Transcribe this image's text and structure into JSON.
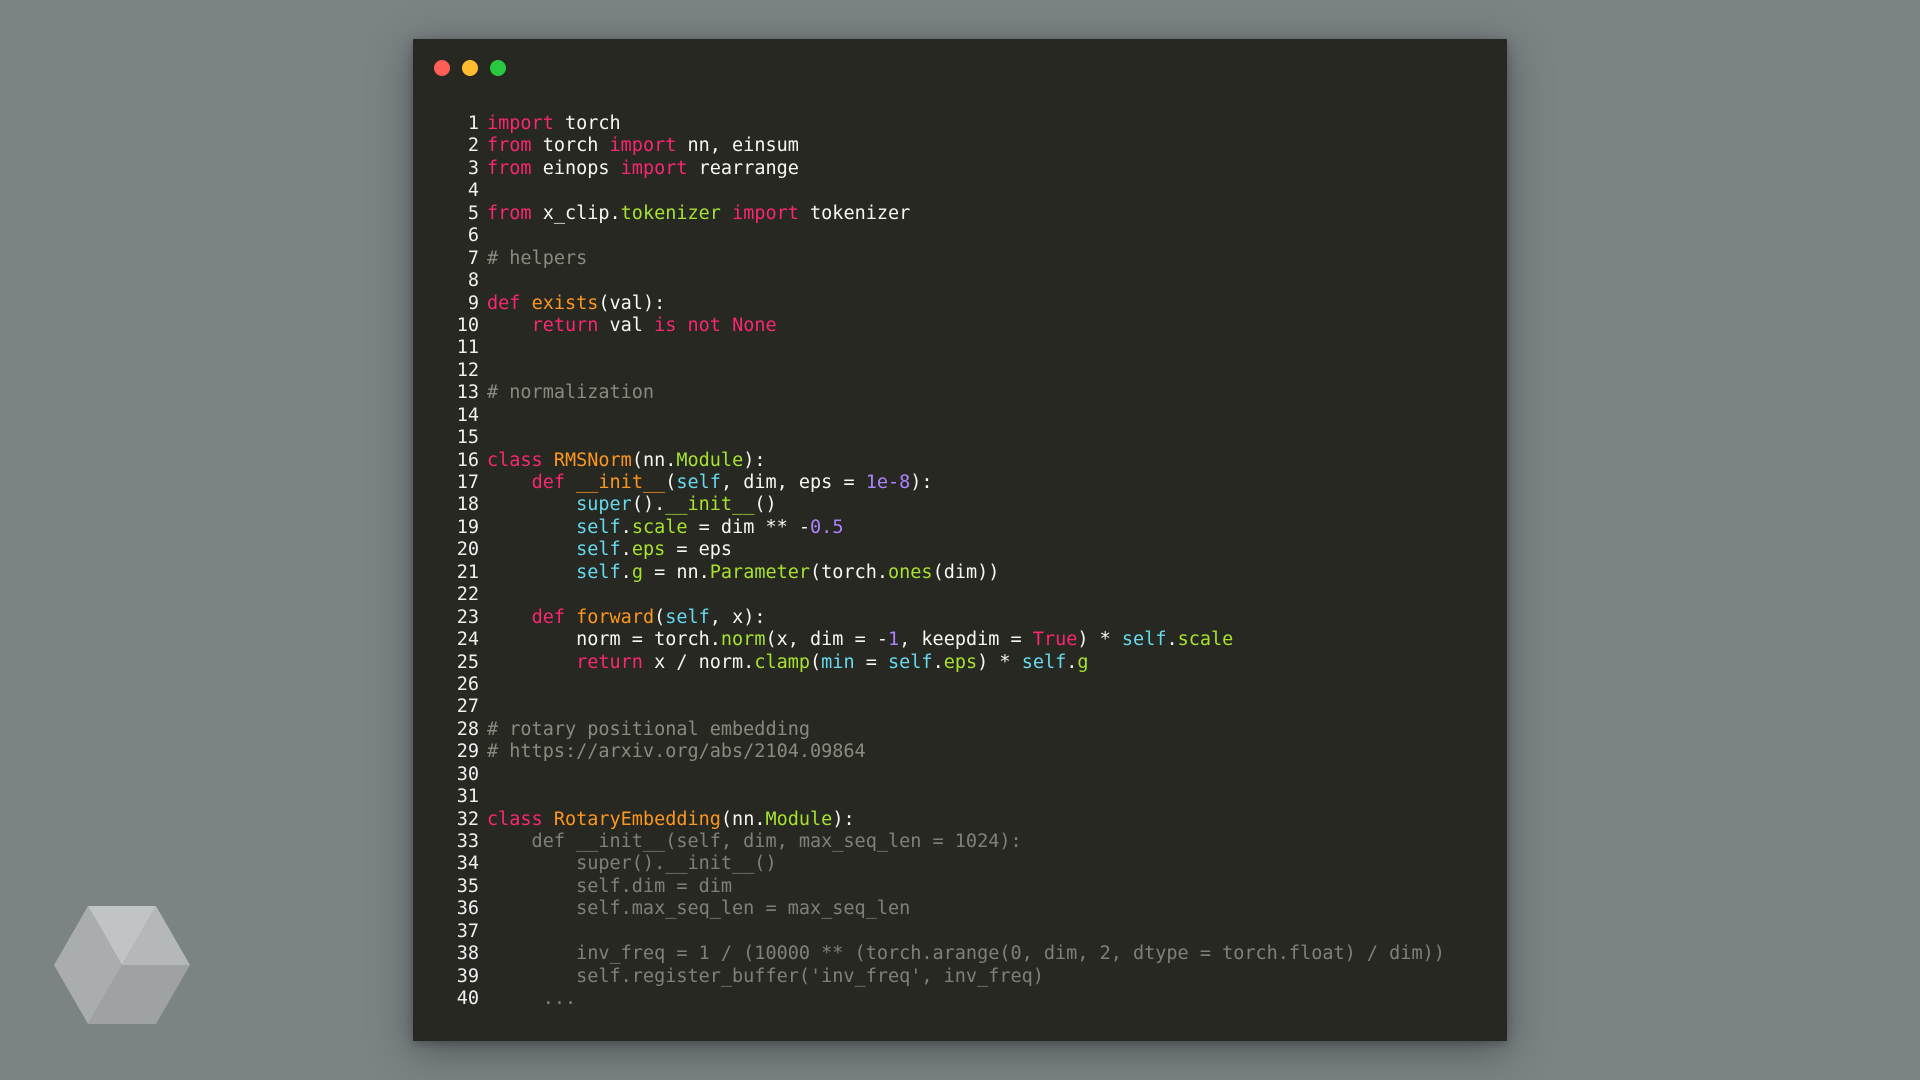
{
  "window": {
    "buttons": [
      {
        "name": "close",
        "color": "#ff5f57"
      },
      {
        "name": "minimize",
        "color": "#febc2e"
      },
      {
        "name": "zoom",
        "color": "#28c840"
      }
    ]
  },
  "colors": {
    "default": "#f8f8f2",
    "kw": "#f92672",
    "mod": "#a6e22e",
    "func": "#fd971f",
    "builtin": "#66d9ef",
    "num": "#ae81ff",
    "cmt": "#8a8a80",
    "dim": "#8c8c84"
  },
  "code_lines": [
    {
      "n": "1",
      "tokens": [
        {
          "t": "import",
          "c": "kw"
        },
        {
          "t": " torch",
          "c": "default"
        }
      ]
    },
    {
      "n": "2",
      "tokens": [
        {
          "t": "from",
          "c": "kw"
        },
        {
          "t": " torch ",
          "c": "default"
        },
        {
          "t": "import",
          "c": "kw"
        },
        {
          "t": " nn, einsum",
          "c": "default"
        }
      ]
    },
    {
      "n": "3",
      "tokens": [
        {
          "t": "from",
          "c": "kw"
        },
        {
          "t": " einops ",
          "c": "default"
        },
        {
          "t": "import",
          "c": "kw"
        },
        {
          "t": " rearrange",
          "c": "default"
        }
      ]
    },
    {
      "n": "4",
      "tokens": []
    },
    {
      "n": "5",
      "tokens": [
        {
          "t": "from",
          "c": "kw"
        },
        {
          "t": " x_clip.",
          "c": "default"
        },
        {
          "t": "tokenizer",
          "c": "mod"
        },
        {
          "t": " ",
          "c": "default"
        },
        {
          "t": "import",
          "c": "kw"
        },
        {
          "t": " tokenizer",
          "c": "default"
        }
      ]
    },
    {
      "n": "6",
      "tokens": []
    },
    {
      "n": "7",
      "tokens": [
        {
          "t": "# helpers",
          "c": "cmt"
        }
      ]
    },
    {
      "n": "8",
      "tokens": []
    },
    {
      "n": "9",
      "tokens": [
        {
          "t": "def",
          "c": "kw"
        },
        {
          "t": " ",
          "c": "default"
        },
        {
          "t": "exists",
          "c": "func"
        },
        {
          "t": "(val):",
          "c": "default"
        }
      ]
    },
    {
      "n": "10",
      "tokens": [
        {
          "t": "    ",
          "c": "default"
        },
        {
          "t": "return",
          "c": "kw"
        },
        {
          "t": " val ",
          "c": "default"
        },
        {
          "t": "is",
          "c": "kw"
        },
        {
          "t": " ",
          "c": "default"
        },
        {
          "t": "not",
          "c": "kw"
        },
        {
          "t": " ",
          "c": "default"
        },
        {
          "t": "None",
          "c": "kw"
        }
      ]
    },
    {
      "n": "11",
      "tokens": []
    },
    {
      "n": "12",
      "tokens": []
    },
    {
      "n": "13",
      "tokens": [
        {
          "t": "# normalization",
          "c": "cmt"
        }
      ]
    },
    {
      "n": "14",
      "tokens": []
    },
    {
      "n": "15",
      "tokens": []
    },
    {
      "n": "16",
      "tokens": [
        {
          "t": "class",
          "c": "kw"
        },
        {
          "t": " ",
          "c": "default"
        },
        {
          "t": "RMSNorm",
          "c": "func"
        },
        {
          "t": "(nn.",
          "c": "default"
        },
        {
          "t": "Module",
          "c": "mod"
        },
        {
          "t": "):",
          "c": "default"
        }
      ]
    },
    {
      "n": "17",
      "tokens": [
        {
          "t": "    ",
          "c": "default"
        },
        {
          "t": "def",
          "c": "kw"
        },
        {
          "t": " ",
          "c": "default"
        },
        {
          "t": "__init__",
          "c": "func"
        },
        {
          "t": "(",
          "c": "default"
        },
        {
          "t": "self",
          "c": "builtin"
        },
        {
          "t": ", dim, eps = ",
          "c": "default"
        },
        {
          "t": "1e-8",
          "c": "num"
        },
        {
          "t": "):",
          "c": "default"
        }
      ]
    },
    {
      "n": "18",
      "tokens": [
        {
          "t": "        ",
          "c": "default"
        },
        {
          "t": "super",
          "c": "builtin"
        },
        {
          "t": "().",
          "c": "default"
        },
        {
          "t": "__init__",
          "c": "mod"
        },
        {
          "t": "()",
          "c": "default"
        }
      ]
    },
    {
      "n": "19",
      "tokens": [
        {
          "t": "        ",
          "c": "default"
        },
        {
          "t": "self",
          "c": "builtin"
        },
        {
          "t": ".",
          "c": "default"
        },
        {
          "t": "scale",
          "c": "mod"
        },
        {
          "t": " = dim ** -",
          "c": "default"
        },
        {
          "t": "0.5",
          "c": "num"
        }
      ]
    },
    {
      "n": "20",
      "tokens": [
        {
          "t": "        ",
          "c": "default"
        },
        {
          "t": "self",
          "c": "builtin"
        },
        {
          "t": ".",
          "c": "default"
        },
        {
          "t": "eps",
          "c": "mod"
        },
        {
          "t": " = eps",
          "c": "default"
        }
      ]
    },
    {
      "n": "21",
      "tokens": [
        {
          "t": "        ",
          "c": "default"
        },
        {
          "t": "self",
          "c": "builtin"
        },
        {
          "t": ".",
          "c": "default"
        },
        {
          "t": "g",
          "c": "mod"
        },
        {
          "t": " = nn.",
          "c": "default"
        },
        {
          "t": "Parameter",
          "c": "mod"
        },
        {
          "t": "(torch.",
          "c": "default"
        },
        {
          "t": "ones",
          "c": "mod"
        },
        {
          "t": "(dim))",
          "c": "default"
        }
      ]
    },
    {
      "n": "22",
      "tokens": []
    },
    {
      "n": "23",
      "tokens": [
        {
          "t": "    ",
          "c": "default"
        },
        {
          "t": "def",
          "c": "kw"
        },
        {
          "t": " ",
          "c": "default"
        },
        {
          "t": "forward",
          "c": "func"
        },
        {
          "t": "(",
          "c": "default"
        },
        {
          "t": "self",
          "c": "builtin"
        },
        {
          "t": ", x):",
          "c": "default"
        }
      ]
    },
    {
      "n": "24",
      "tokens": [
        {
          "t": "        norm = torch.",
          "c": "default"
        },
        {
          "t": "norm",
          "c": "mod"
        },
        {
          "t": "(x, dim = -",
          "c": "default"
        },
        {
          "t": "1",
          "c": "num"
        },
        {
          "t": ", keepdim = ",
          "c": "default"
        },
        {
          "t": "True",
          "c": "kw"
        },
        {
          "t": ") * ",
          "c": "default"
        },
        {
          "t": "self",
          "c": "builtin"
        },
        {
          "t": ".",
          "c": "default"
        },
        {
          "t": "scale",
          "c": "mod"
        }
      ]
    },
    {
      "n": "25",
      "tokens": [
        {
          "t": "        ",
          "c": "default"
        },
        {
          "t": "return",
          "c": "kw"
        },
        {
          "t": " x / norm.",
          "c": "default"
        },
        {
          "t": "clamp",
          "c": "mod"
        },
        {
          "t": "(",
          "c": "default"
        },
        {
          "t": "min",
          "c": "builtin"
        },
        {
          "t": " = ",
          "c": "default"
        },
        {
          "t": "self",
          "c": "builtin"
        },
        {
          "t": ".",
          "c": "default"
        },
        {
          "t": "eps",
          "c": "mod"
        },
        {
          "t": ") * ",
          "c": "default"
        },
        {
          "t": "self",
          "c": "builtin"
        },
        {
          "t": ".",
          "c": "default"
        },
        {
          "t": "g",
          "c": "mod"
        }
      ]
    },
    {
      "n": "26",
      "tokens": []
    },
    {
      "n": "27",
      "tokens": []
    },
    {
      "n": "28",
      "tokens": [
        {
          "t": "# rotary positional embedding",
          "c": "cmt"
        }
      ]
    },
    {
      "n": "29",
      "tokens": [
        {
          "t": "# https://arxiv.org/abs/2104.09864",
          "c": "cmt"
        }
      ]
    },
    {
      "n": "30",
      "tokens": []
    },
    {
      "n": "31",
      "tokens": []
    },
    {
      "n": "32",
      "tokens": [
        {
          "t": "class",
          "c": "kw"
        },
        {
          "t": " ",
          "c": "default"
        },
        {
          "t": "RotaryEmbedding",
          "c": "func"
        },
        {
          "t": "(nn.",
          "c": "default"
        },
        {
          "t": "Module",
          "c": "mod"
        },
        {
          "t": "):",
          "c": "default"
        }
      ]
    },
    {
      "n": "33",
      "dim": true,
      "tokens": [
        {
          "t": "    def __init__(self, dim, max_seq_len = 1024):",
          "c": "default"
        }
      ]
    },
    {
      "n": "34",
      "dim": true,
      "tokens": [
        {
          "t": "        super().__init__()",
          "c": "default"
        }
      ]
    },
    {
      "n": "35",
      "dim": true,
      "tokens": [
        {
          "t": "        self.dim = dim",
          "c": "default"
        }
      ]
    },
    {
      "n": "36",
      "dim": true,
      "tokens": [
        {
          "t": "        self.max_seq_len = max_seq_len",
          "c": "default"
        }
      ]
    },
    {
      "n": "37",
      "dim": true,
      "tokens": []
    },
    {
      "n": "38",
      "dim": true,
      "tokens": [
        {
          "t": "        inv_freq = 1 / (10000 ** (torch.arange(0, dim, 2, dtype = torch.float) / dim))",
          "c": "default"
        }
      ]
    },
    {
      "n": "39",
      "dim": true,
      "tokens": [
        {
          "t": "        self.register_buffer('inv_freq', inv_freq)",
          "c": "default"
        }
      ]
    },
    {
      "n": "40",
      "dim": true,
      "tokens": [
        {
          "t": "     ...",
          "c": "default"
        }
      ]
    }
  ]
}
